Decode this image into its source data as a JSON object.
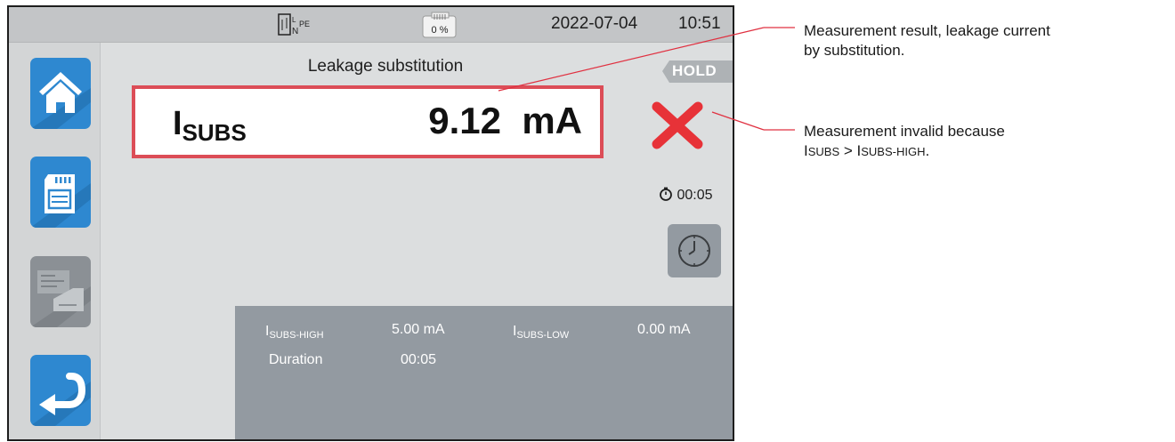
{
  "topbar": {
    "pe_label": "PE",
    "n_label": "N",
    "l_label": "L",
    "battery_text": "0 %",
    "date": "2022-07-04",
    "time": "10:51"
  },
  "sidebar": {
    "items": [
      {
        "icon": "home-icon"
      },
      {
        "icon": "memory-card-icon"
      },
      {
        "icon": "recall-results-icon"
      },
      {
        "icon": "back-icon"
      }
    ]
  },
  "main": {
    "title": "Leakage substitution",
    "hold_label": "HOLD",
    "result": {
      "symbol": "I",
      "symbol_sub": "SUBS",
      "value": "9.12",
      "unit": "mA"
    },
    "status_icon": "fail-cross-icon",
    "status_color": "#e73238",
    "timer": "00:05"
  },
  "params": {
    "high_label": "I",
    "high_sub": "SUBS-HIGH",
    "high_value": "5.00 mA",
    "low_label": "I",
    "low_sub": "SUBS-LOW",
    "low_value": "0.00 mA",
    "duration_label": "Duration",
    "duration_value": "00:05"
  },
  "annotations": {
    "result_note_1": "Measurement result, leakage current",
    "result_note_2": "by substitution.",
    "invalid_note_1": "Measurement invalid because",
    "invalid_i1": "I",
    "invalid_sub1": "SUBS",
    "invalid_gt": " > ",
    "invalid_i2": "I",
    "invalid_sub2": "SUBS-HIGH",
    "invalid_end": "."
  },
  "colors": {
    "accent_blue": "#2e88d0",
    "result_border": "#dc4d57",
    "panel_gray": "#939aa1"
  }
}
